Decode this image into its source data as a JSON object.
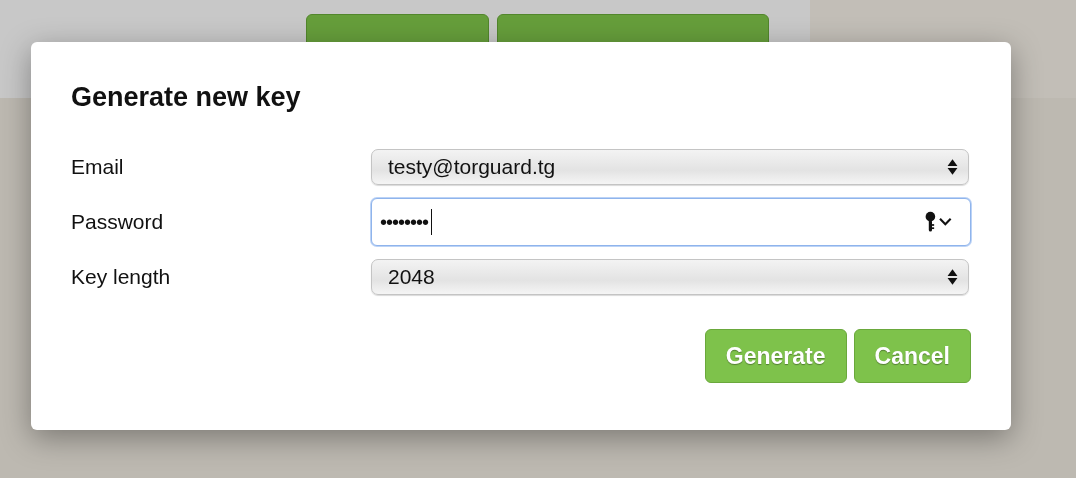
{
  "dialog": {
    "title": "Generate new key",
    "fields": [
      {
        "kind": "select",
        "label": "Email",
        "value": "testy@torguard.tg",
        "focused": false
      },
      {
        "kind": "password",
        "label": "Password",
        "value": "••••••••",
        "focused": true
      },
      {
        "kind": "select",
        "label": "Key length",
        "value": "2048",
        "focused": false
      }
    ],
    "buttons": [
      "Generate",
      "Cancel"
    ]
  }
}
